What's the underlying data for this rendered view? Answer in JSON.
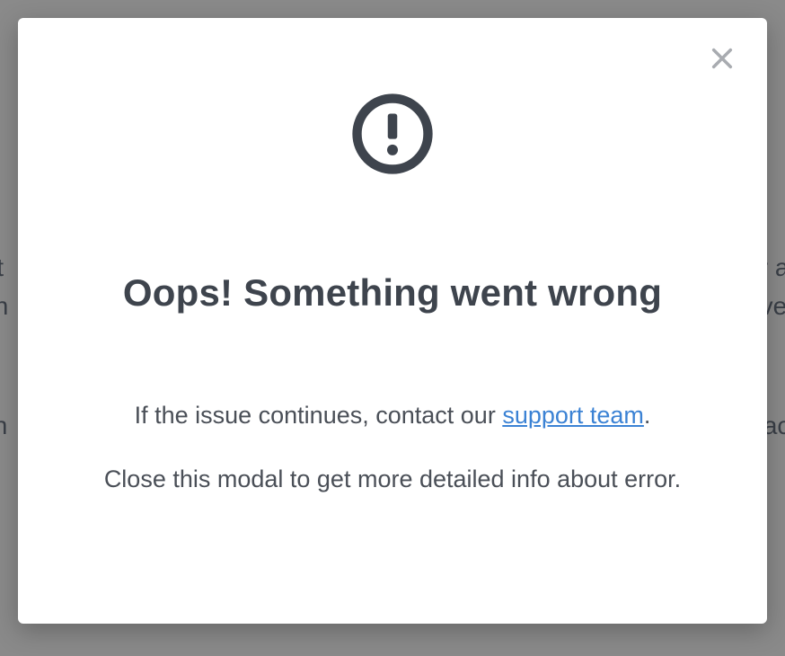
{
  "background": {
    "fragment_left_1": "it",
    "fragment_right_1": "er an",
    "fragment_left_2": "gin",
    "fragment_right_2": "veCh",
    "fragment_left_3": "th",
    "fragment_right_3": "tact c"
  },
  "modal": {
    "heading": "Oops! Something went wrong",
    "line1_prefix": "If the issue continues, contact our ",
    "line1_link": "support team",
    "line1_suffix": ".",
    "line2": "Close this modal to get more detailed info about error."
  }
}
